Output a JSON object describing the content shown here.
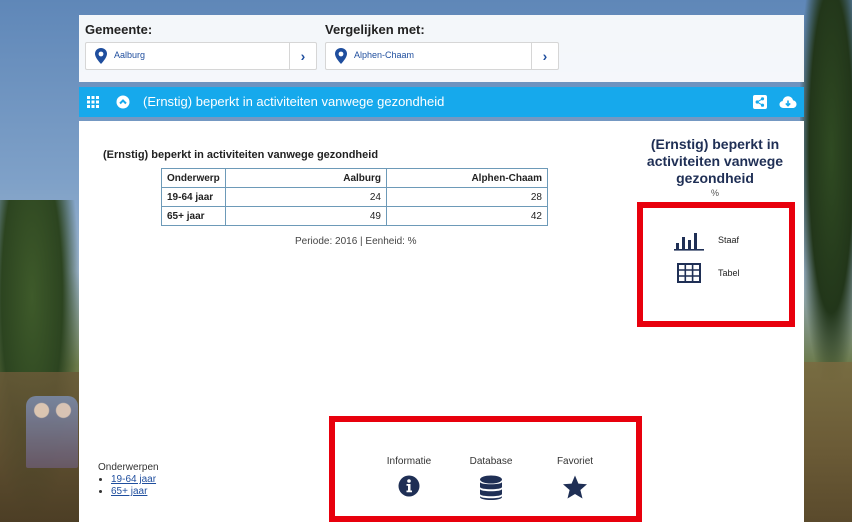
{
  "selector": {
    "gemeente_label": "Gemeente:",
    "gemeente_value": "Aalburg",
    "vergelijken_label": "Vergelijken met:",
    "vergelijken_value": "Alphen-Chaam"
  },
  "titlebar": {
    "title": "(Ernstig) beperkt in activiteiten vanwege gezondheid",
    "bg_color": "#16a9ec"
  },
  "table": {
    "title": "(Ernstig) beperkt in activiteiten vanwege gezondheid",
    "headers": [
      "Onderwerp",
      "Aalburg",
      "Alphen-Chaam"
    ],
    "rows": [
      [
        "19-64 jaar",
        "24",
        "28"
      ],
      [
        "65+ jaar",
        "49",
        "42"
      ]
    ],
    "periode": "Periode: 2016 | Eenheid: %"
  },
  "side": {
    "title_line1": "(Ernstig) beperkt in",
    "title_line2": "activiteiten vanwege",
    "title_line3": "gezondheid",
    "unit": "%",
    "options": [
      {
        "label": "Staaf",
        "icon": "bar-chart-icon"
      },
      {
        "label": "Tabel",
        "icon": "table-icon"
      }
    ]
  },
  "footer": {
    "items": [
      {
        "label": "Informatie",
        "icon": "info-icon"
      },
      {
        "label": "Database",
        "icon": "database-icon"
      },
      {
        "label": "Favoriet",
        "icon": "star-icon"
      }
    ]
  },
  "onderwerpen": {
    "heading": "Onderwerpen",
    "items": [
      "19-64 jaar",
      "65+ jaar"
    ]
  },
  "colors": {
    "highlight": "#e8000d",
    "accent": "#16a9ec",
    "link": "#1f4e9e"
  }
}
